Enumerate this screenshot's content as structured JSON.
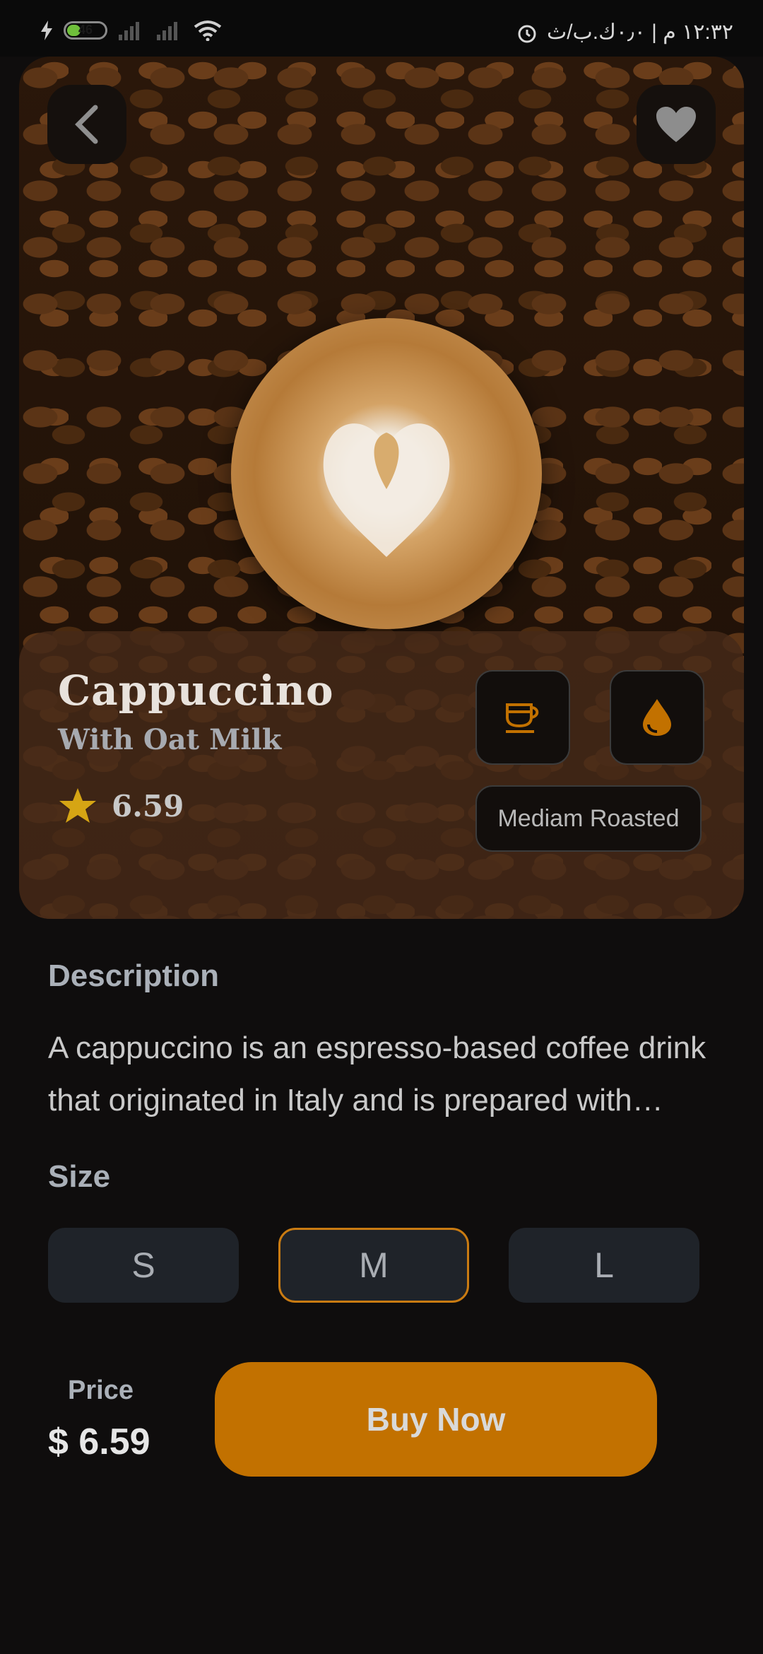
{
  "status_bar": {
    "battery": "46",
    "time": "١٢:٣٢ م | ٠٫٠ك.ب/ث"
  },
  "product": {
    "name": "Cappuccino",
    "subtitle": "With Oat Milk",
    "rating": "6.59",
    "roast": "Mediam Roasted"
  },
  "description": {
    "title": "Description",
    "text": "A cappuccino  is an espresso-based coffee drink that originated in Italy and is prepared with steamed milk foam."
  },
  "size": {
    "title": "Size",
    "options": [
      "S",
      "M",
      "L"
    ],
    "selected": "M"
  },
  "footer": {
    "price_label": "Price",
    "price_value": "$ 6.59",
    "buy_label": "Buy Now"
  },
  "colors": {
    "accent": "#c27100",
    "background": "#0f0d0d",
    "size_button": "#1f2329"
  },
  "icons": {
    "back": "chevron-left-icon",
    "favorite": "heart-icon",
    "rating": "star-icon",
    "coffee": "coffee-cup-icon",
    "milk": "drop-icon"
  }
}
